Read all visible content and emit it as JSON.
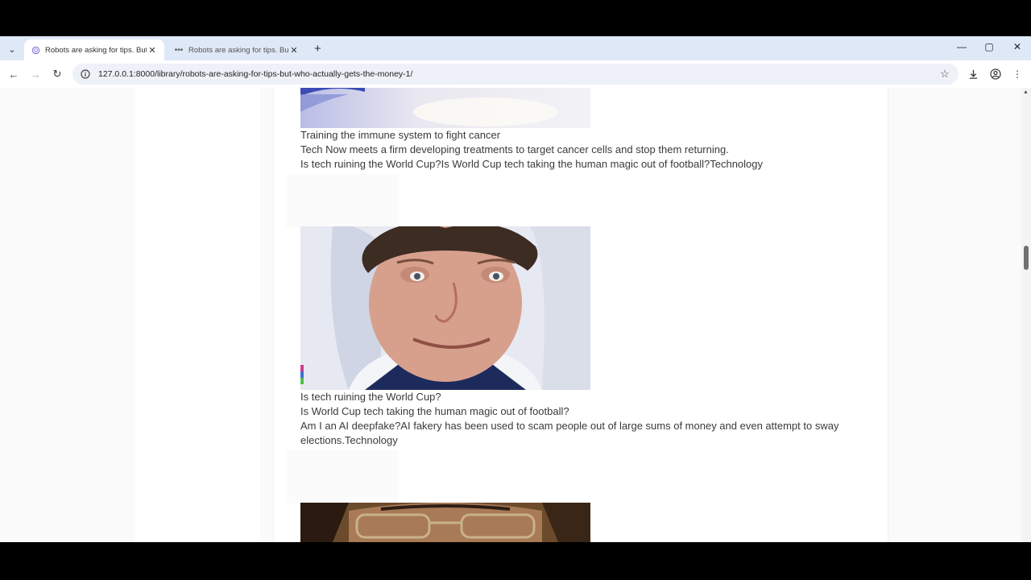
{
  "browser": {
    "tabs": [
      {
        "title": "Robots are asking for tips. But w",
        "active": true
      },
      {
        "title": "Robots are asking for tips. But w",
        "active": false
      }
    ],
    "url": "127.0.0.1:8000/library/robots-are-asking-for-tips-but-who-actually-gets-the-money-1/"
  },
  "article": {
    "block1": {
      "title": "Training the immune system to fight cancer",
      "summary": "Tech Now meets a firm developing treatments to target cancer cells and stop them returning.",
      "next": "Is tech ruining the World Cup?Is World Cup tech taking the human magic out of football?Technology"
    },
    "block2": {
      "title": "Is tech ruining the World Cup?",
      "summary": "Is World Cup tech taking the human magic out of football?",
      "next": "Am I an AI deepfake?AI fakery has been used to scam people out of large sums of money and even attempt to sway elections.Technology"
    }
  }
}
